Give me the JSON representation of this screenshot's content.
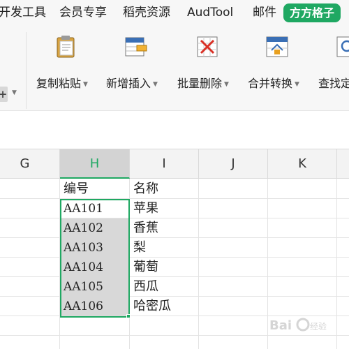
{
  "menu": {
    "tabs": [
      {
        "label": "开发工具"
      },
      {
        "label": "会员专享"
      },
      {
        "label": "稻壳资源"
      },
      {
        "label": "AudTool"
      },
      {
        "label": "邮件"
      }
    ],
    "active_tab": "方方格子"
  },
  "ribbon": {
    "tools": [
      {
        "label": "复制粘贴",
        "icon": "clipboard-icon"
      },
      {
        "label": "新增插入",
        "icon": "insert-icon"
      },
      {
        "label": "批量删除",
        "icon": "delete-icon"
      },
      {
        "label": "合并转换",
        "icon": "merge-convert-icon"
      },
      {
        "label": "查找定",
        "icon": "find-icon"
      }
    ],
    "left_ctrl": "+"
  },
  "columns": [
    "G",
    "H",
    "I",
    "J",
    "K"
  ],
  "active_column": "H",
  "rows": [
    {
      "h": "编号",
      "i": "名称"
    },
    {
      "h": "AA101",
      "i": "苹果"
    },
    {
      "h": "AA102",
      "i": "香蕉"
    },
    {
      "h": "AA103",
      "i": "梨"
    },
    {
      "h": "AA104",
      "i": "葡萄"
    },
    {
      "h": "AA105",
      "i": "西瓜"
    },
    {
      "h": "AA106",
      "i": "哈密瓜"
    }
  ],
  "colors": {
    "accent": "#1fa862",
    "selection_fill": "#d8d8d8",
    "header_bg": "#f3f3f3"
  }
}
